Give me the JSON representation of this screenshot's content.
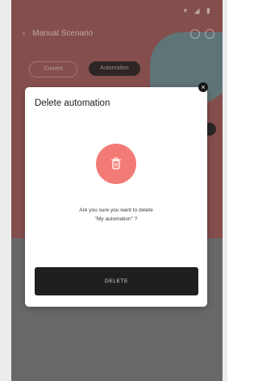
{
  "background": {
    "status_icons": "▾ ◢ ▮",
    "back_glyph": "‹",
    "screen_title": "Manual Scenario",
    "tab_a": "Current",
    "tab_b": "Automation"
  },
  "dialog": {
    "title": "Delete automation",
    "close_glyph": "×",
    "message_line1": "Are you sure you want to delete",
    "message_line2": "\"My automation\" ?",
    "delete_label": "DELETE"
  },
  "colors": {
    "accent": "#f37b76",
    "button_bg": "#1f1f1f"
  }
}
